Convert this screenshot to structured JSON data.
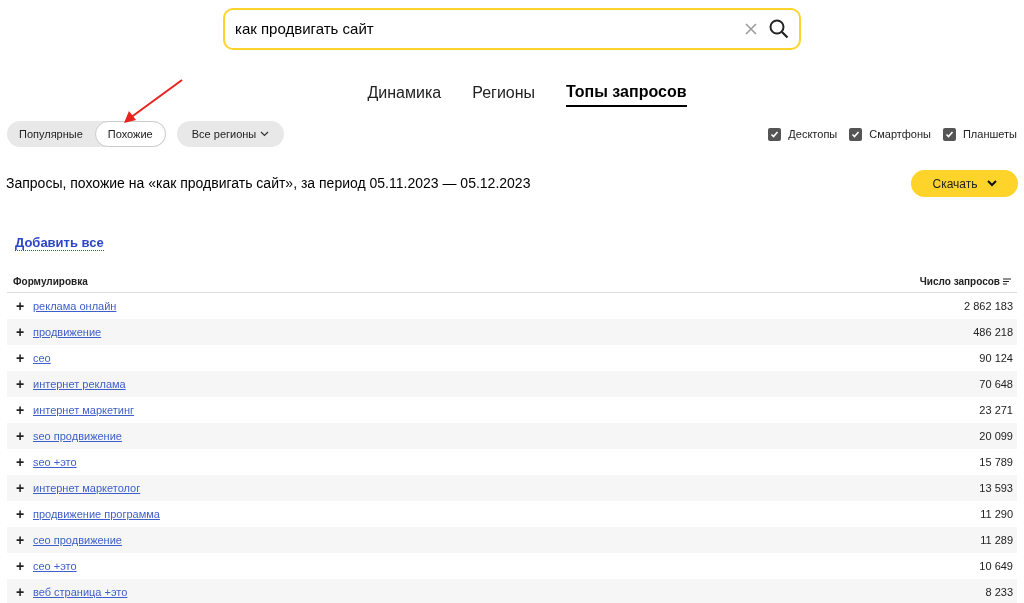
{
  "search": {
    "value": "как продвигать сайт"
  },
  "tabs": [
    {
      "label": "Динамика",
      "selected": false
    },
    {
      "label": "Регионы",
      "selected": false
    },
    {
      "label": "Топы запросов",
      "selected": true
    }
  ],
  "mode_switch": [
    {
      "label": "Популярные",
      "selected": false
    },
    {
      "label": "Похожие",
      "selected": true
    }
  ],
  "region_dropdown": {
    "label": "Все регионы"
  },
  "devices": [
    {
      "label": "Десктопы",
      "checked": true
    },
    {
      "label": "Смартфоны",
      "checked": true
    },
    {
      "label": "Планшеты",
      "checked": true
    }
  ],
  "heading": "Запросы, похожие на «как продвигать сайт», за период 05.11.2023 — 05.12.2023",
  "download_button": {
    "label": "Скачать"
  },
  "add_all_link": "Добавить все",
  "table": {
    "columns": [
      "Формулировка",
      "Число запросов"
    ],
    "rows": [
      {
        "add": "+",
        "query": "реклама онлайн",
        "count": "2 862 183"
      },
      {
        "add": "+",
        "query": "продвижение",
        "count": "486 218"
      },
      {
        "add": "+",
        "query": "сео",
        "count": "90 124"
      },
      {
        "add": "+",
        "query": "интернет реклама",
        "count": "70 648"
      },
      {
        "add": "+",
        "query": "интернет маркетинг",
        "count": "23 271"
      },
      {
        "add": "+",
        "query": "seo продвижение",
        "count": "20 099"
      },
      {
        "add": "+",
        "query": "seo +это",
        "count": "15 789"
      },
      {
        "add": "+",
        "query": "интернет маркетолог",
        "count": "13 593"
      },
      {
        "add": "+",
        "query": "продвижение программа",
        "count": "11 290"
      },
      {
        "add": "+",
        "query": "сео продвижение",
        "count": "11 289"
      },
      {
        "add": "+",
        "query": "сео +это",
        "count": "10 649"
      },
      {
        "add": "+",
        "query": "веб страница +это",
        "count": "8 233"
      }
    ]
  }
}
